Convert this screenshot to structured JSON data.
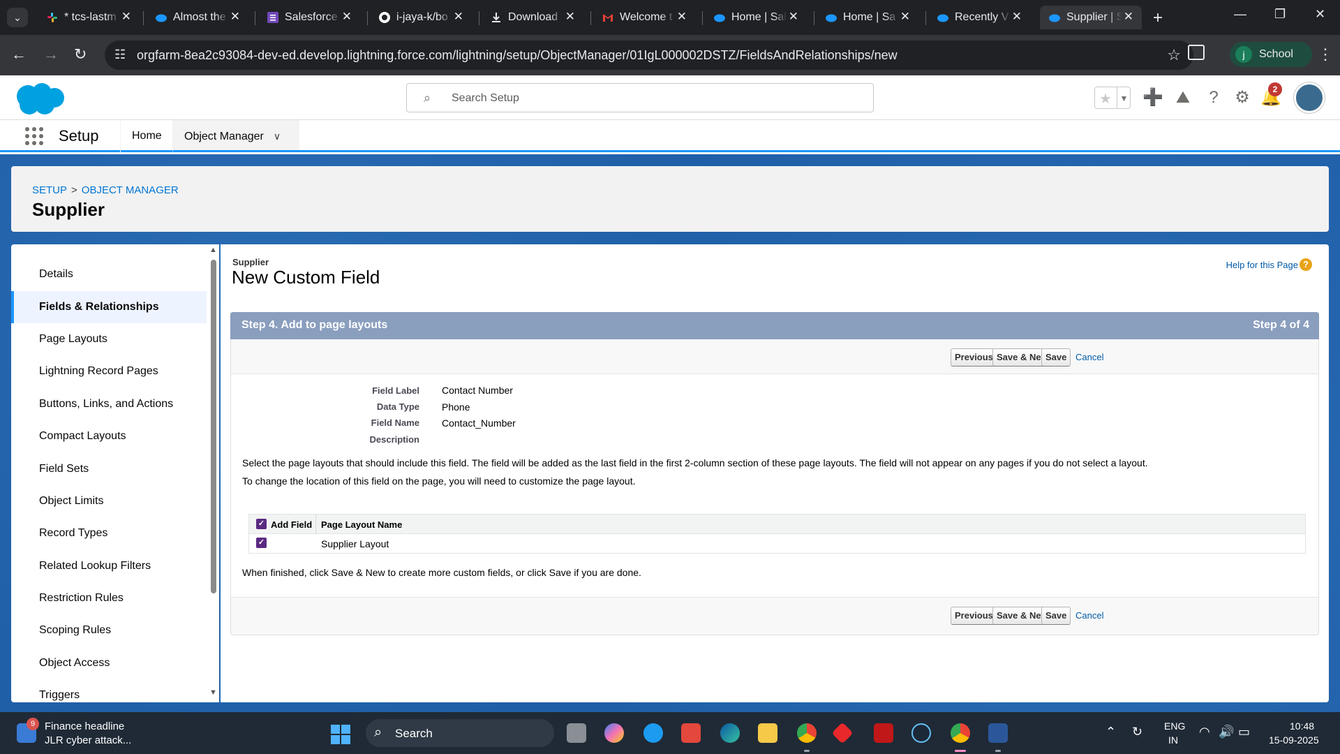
{
  "browser": {
    "tabs": [
      {
        "title": "* tcs-lastm",
        "icon": "slack-icon",
        "color": "#e01e5a"
      },
      {
        "title": "Almost the",
        "icon": "salesforce-icon",
        "color": "#1b96ff"
      },
      {
        "title": "Salesforce",
        "icon": "forms-icon",
        "color": "#7248b9"
      },
      {
        "title": "i-jaya-k/bo",
        "icon": "github-icon",
        "color": "#ffffff"
      },
      {
        "title": "Download",
        "icon": "download-icon",
        "color": "#e8eaed"
      },
      {
        "title": "Welcome t",
        "icon": "gmail-icon",
        "color": "#ea4335"
      },
      {
        "title": "Home | Sal",
        "icon": "salesforce-icon",
        "color": "#1b96ff"
      },
      {
        "title": "Home | Sa",
        "icon": "salesforce-icon",
        "color": "#1b96ff"
      },
      {
        "title": "Recently V",
        "icon": "salesforce-icon",
        "color": "#1b96ff"
      },
      {
        "title": "Supplier | S",
        "icon": "salesforce-icon",
        "color": "#1b96ff"
      }
    ],
    "url": "orgfarm-8ea2c93084-dev-ed.develop.lightning.force.com/lightning/setup/ObjectManager/01IgL000002DSTZ/FieldsAndRelationships/new",
    "profile_label": "School",
    "profile_initial": "j"
  },
  "sf": {
    "search_placeholder": "Search Setup",
    "notification_count": "2",
    "app_name": "Setup",
    "nav": {
      "home": "Home",
      "object_manager": "Object Manager"
    }
  },
  "page_header": {
    "crumb_setup": "SETUP",
    "crumb_sep": ">",
    "crumb_object_manager": "OBJECT MANAGER",
    "title": "Supplier"
  },
  "sidebar": {
    "items": [
      {
        "label": "Details",
        "active": false
      },
      {
        "label": "Fields & Relationships",
        "active": true
      },
      {
        "label": "Page Layouts",
        "active": false
      },
      {
        "label": "Lightning Record Pages",
        "active": false
      },
      {
        "label": "Buttons, Links, and Actions",
        "active": false
      },
      {
        "label": "Compact Layouts",
        "active": false
      },
      {
        "label": "Field Sets",
        "active": false
      },
      {
        "label": "Object Limits",
        "active": false
      },
      {
        "label": "Record Types",
        "active": false
      },
      {
        "label": "Related Lookup Filters",
        "active": false
      },
      {
        "label": "Restriction Rules",
        "active": false
      },
      {
        "label": "Scoping Rules",
        "active": false
      },
      {
        "label": "Object Access",
        "active": false
      },
      {
        "label": "Triggers",
        "active": false
      }
    ]
  },
  "main": {
    "object_label": "Supplier",
    "title": "New Custom Field",
    "help_link": "Help for this Page",
    "step_title": "Step 4. Add to page layouts",
    "step_count": "Step 4 of 4",
    "buttons": {
      "previous": "Previous",
      "save_new": "Save & New",
      "save": "Save",
      "cancel": "Cancel"
    },
    "details": [
      {
        "label": "Field Label",
        "value": "Contact Number"
      },
      {
        "label": "Data Type",
        "value": "Phone"
      },
      {
        "label": "Field Name",
        "value": "Contact_Number"
      },
      {
        "label": "Description",
        "value": ""
      }
    ],
    "instructions": "Select the page layouts that should include this field. The field will be added as the last field in the first 2-column section of these page layouts. The field will not appear on any pages if you do not select a layout.",
    "location_note": "To change the location of this field on the page, you will need to customize the page layout.",
    "table": {
      "headers": [
        "Add Field",
        "Page Layout Name"
      ],
      "rows": [
        {
          "checked": true,
          "name": "Supplier Layout"
        }
      ]
    },
    "finish_note": "When finished, click Save & New to create more custom fields, or click Save if you are done."
  },
  "taskbar": {
    "news_title": "Finance headline",
    "news_subtitle": "JLR cyber attack...",
    "news_badge": "9",
    "search_label": "Search",
    "lang_line1": "ENG",
    "lang_line2": "IN",
    "time": "10:48",
    "date": "15-09-2025"
  }
}
